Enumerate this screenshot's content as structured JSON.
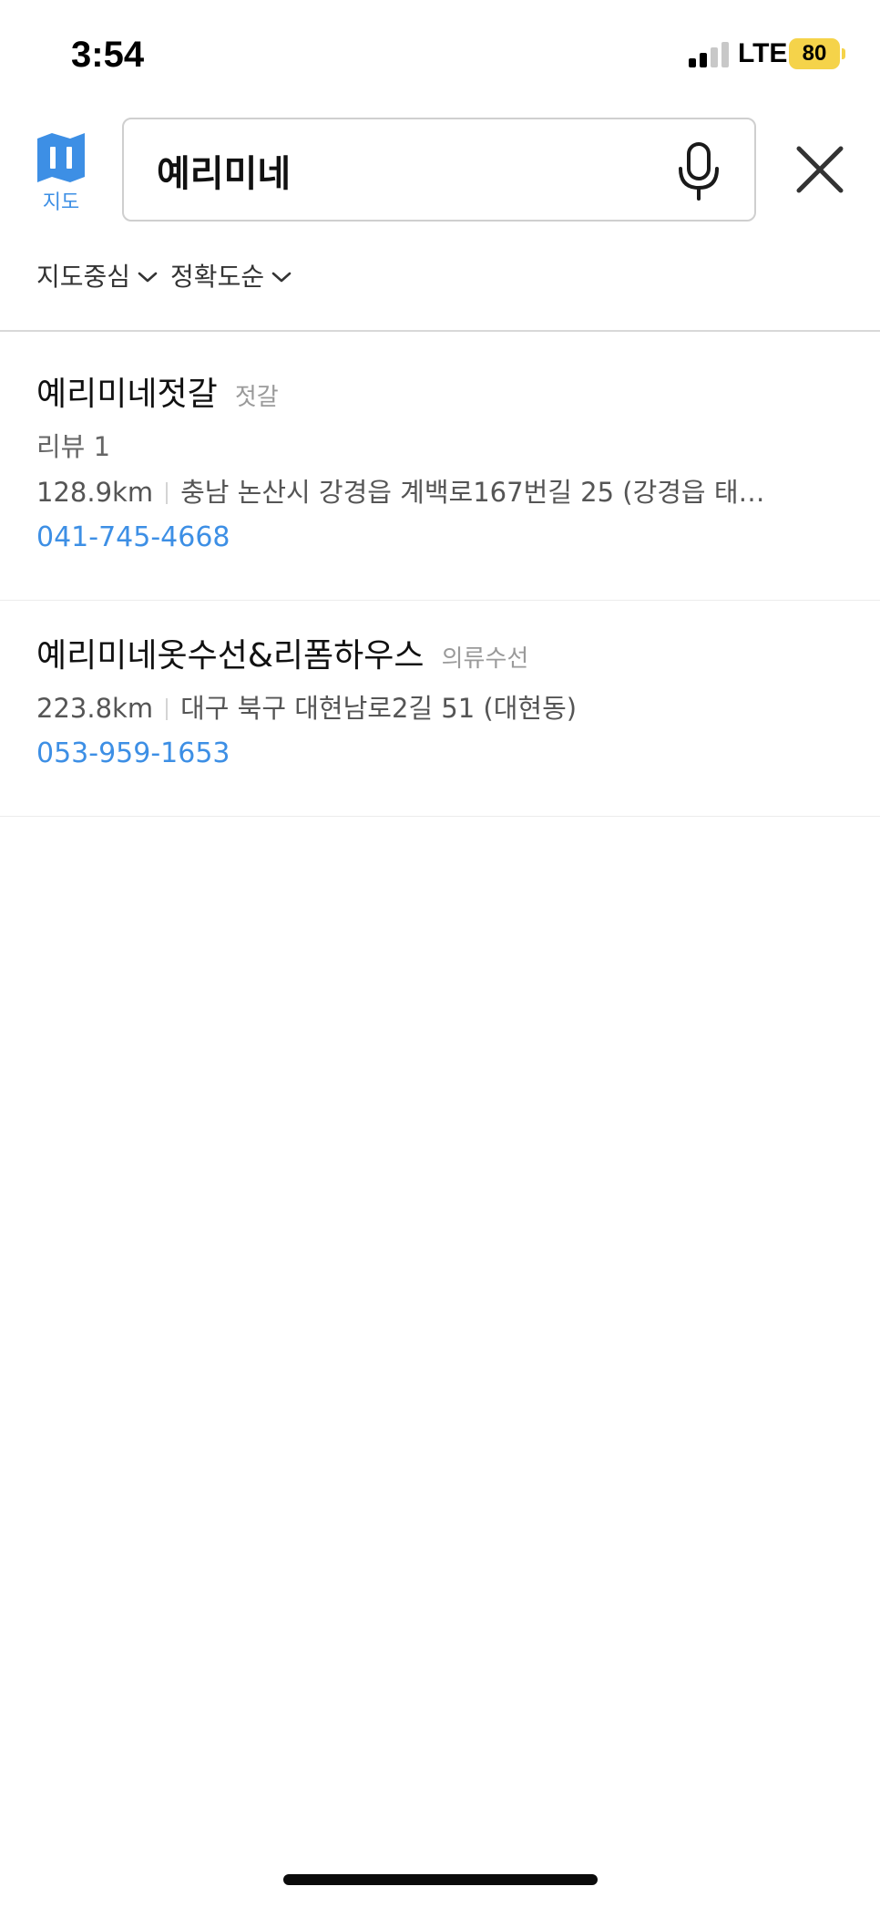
{
  "status_bar": {
    "time": "3:54",
    "network": "LTE",
    "battery": "80"
  },
  "header": {
    "map_button_label": "지도",
    "search": {
      "value": "예리미네",
      "placeholder": ""
    }
  },
  "filters": [
    {
      "label": "지도중심"
    },
    {
      "label": "정확도순"
    }
  ],
  "results": [
    {
      "name": "예리미네젓갈",
      "category": "젓갈",
      "reviews": "리뷰 1",
      "distance": "128.9km",
      "address": "충남 논산시 강경읍 계백로167번길 25 (강경읍 태…",
      "phone": "041-745-4668"
    },
    {
      "name": "예리미네옷수선&리폼하우스",
      "category": "의류수선",
      "distance": "223.8km",
      "address": "대구 북구 대현남로2길 51 (대현동)",
      "phone": "053-959-1653"
    }
  ],
  "colors": {
    "accent_blue": "#3d8fe5",
    "battery_yellow": "#f5d34a",
    "divider": "#d8d8d8"
  },
  "icons": [
    "map-icon",
    "mic-icon",
    "close-icon",
    "chevron-down-icon"
  ]
}
